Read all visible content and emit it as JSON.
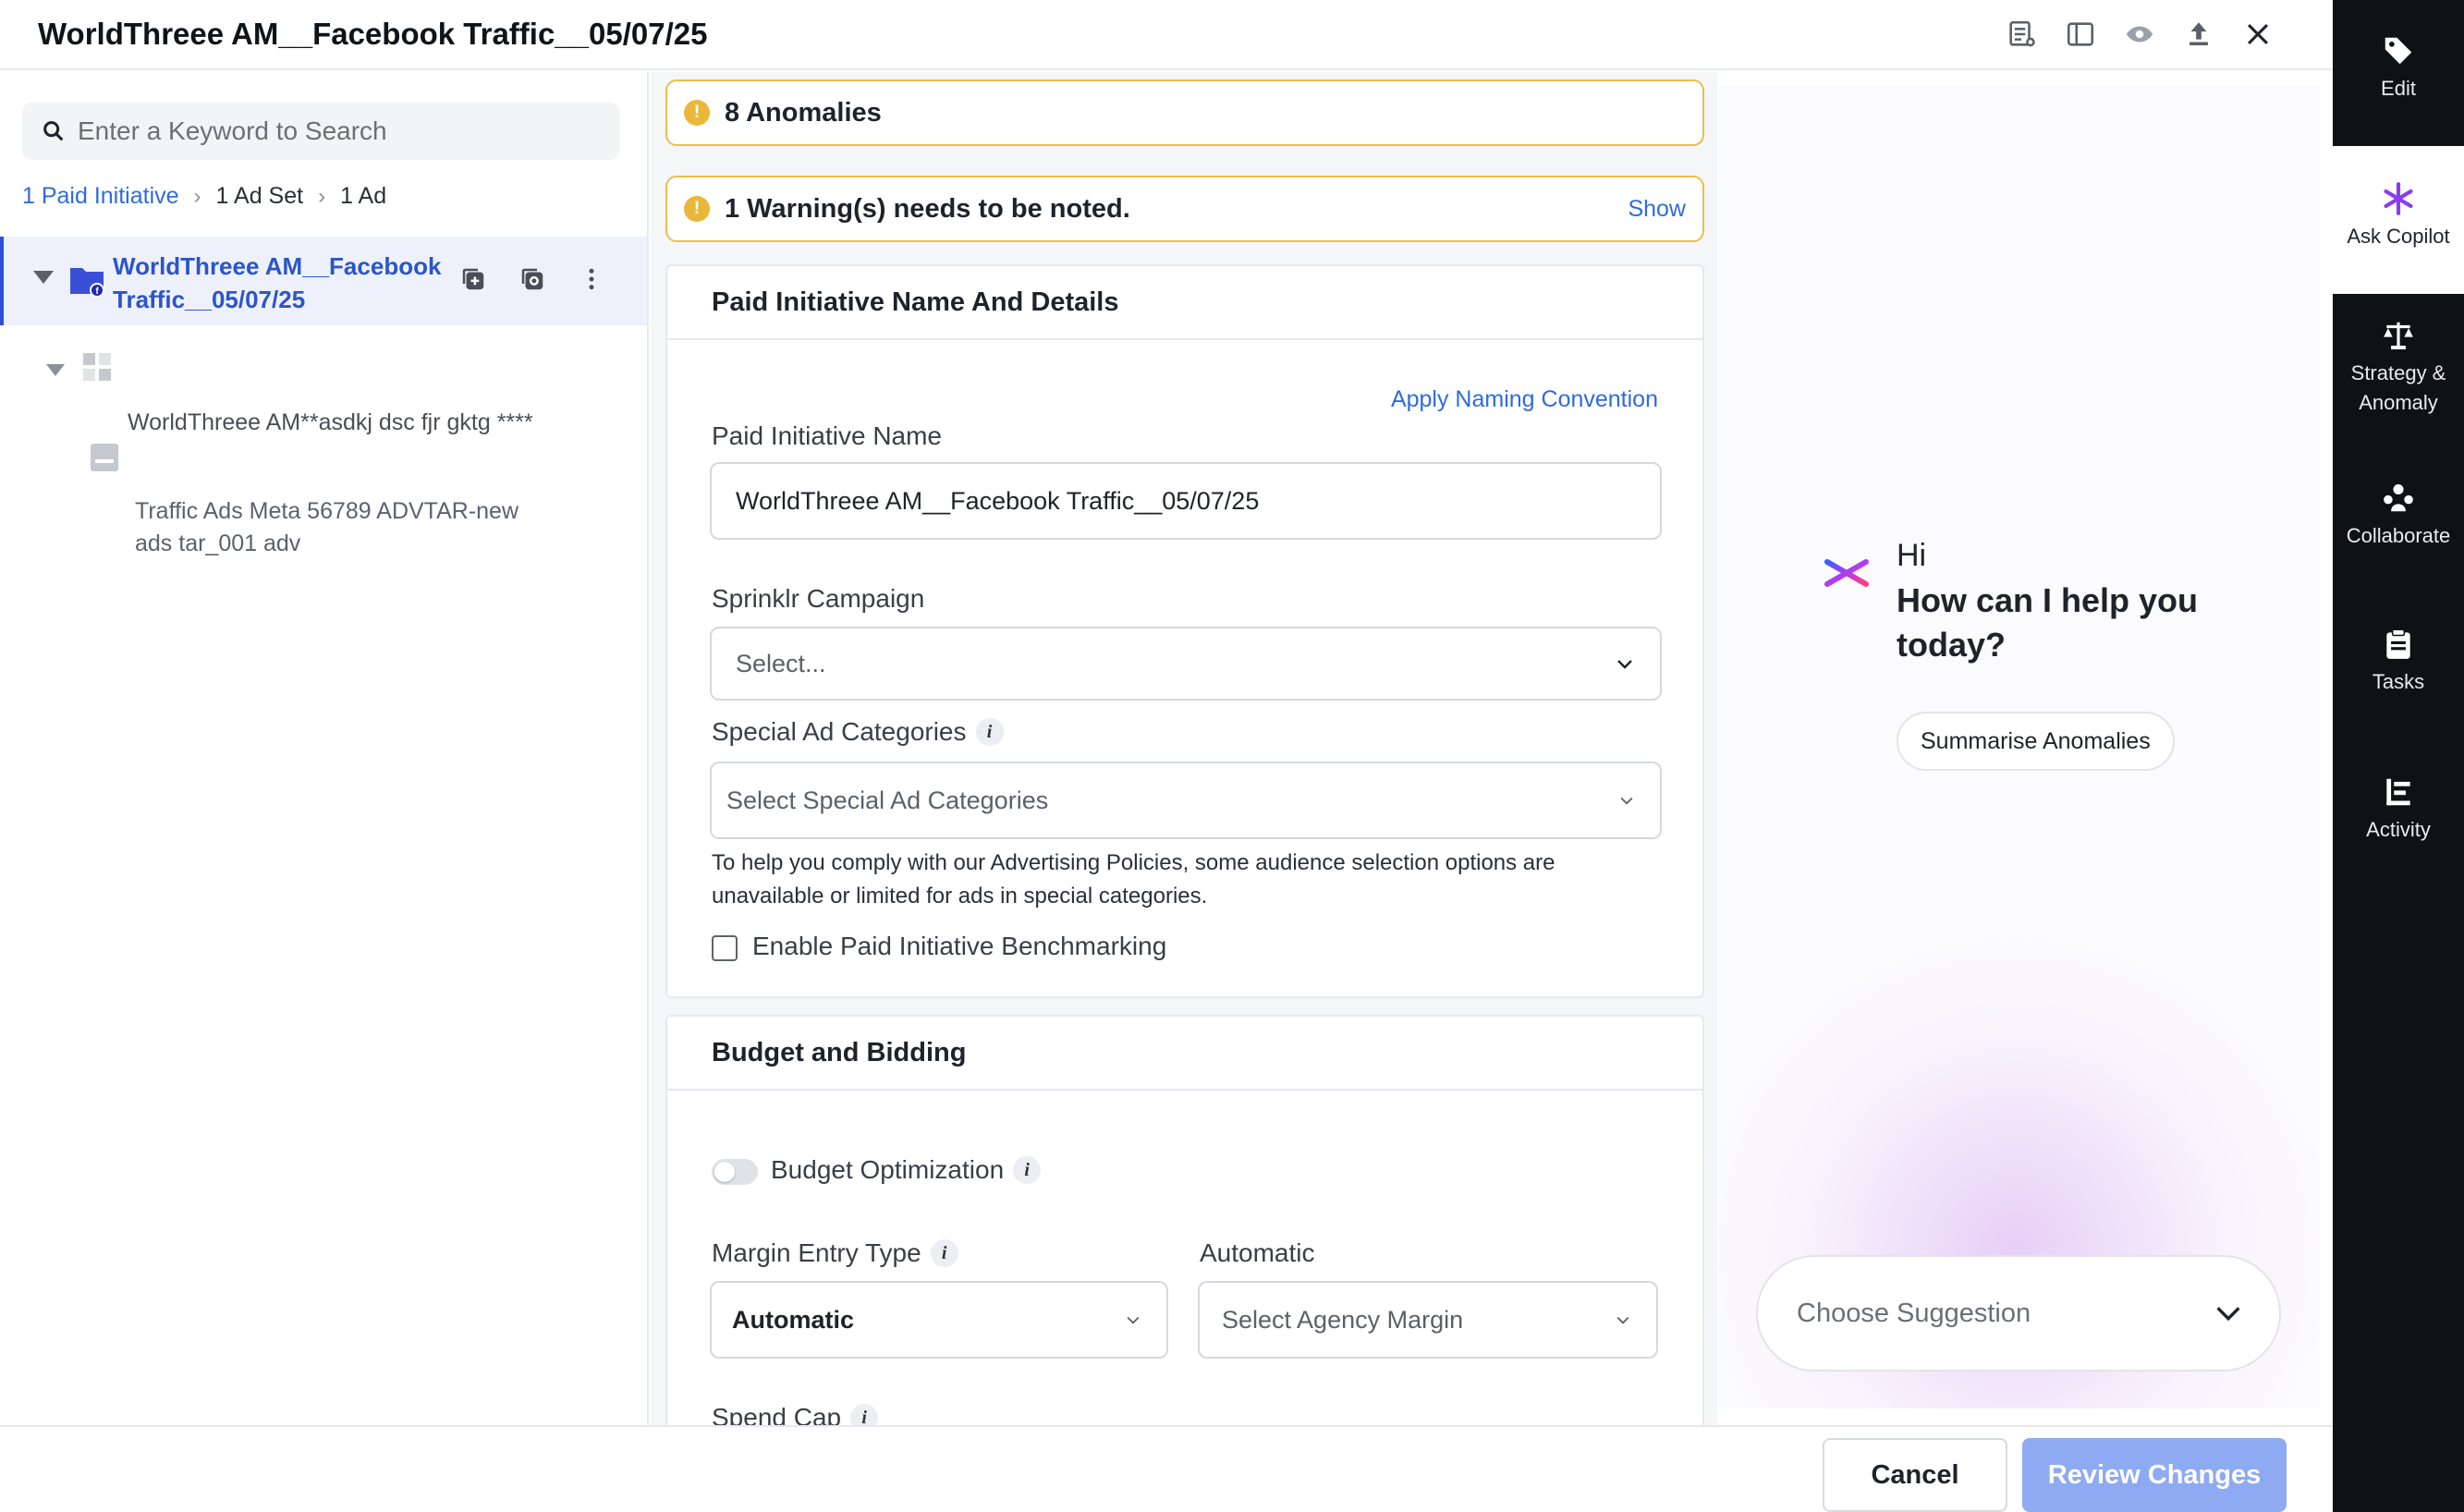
{
  "header": {
    "title": "WorldThreee AM__Facebook Traffic__05/07/25",
    "icons": [
      "list-settings-icon",
      "panel-layout-icon",
      "eye-icon",
      "upload-icon",
      "close-icon"
    ]
  },
  "left_panel": {
    "search": {
      "placeholder": "Enter a Keyword to Search",
      "value": ""
    },
    "breadcrumb": {
      "paid_initiative": "1 Paid Initiative",
      "ad_set": "1 Ad Set",
      "ad": "1 Ad"
    },
    "tree": {
      "initiative": "WorldThreee AM__Facebook Traffic__05/07/25",
      "ad_set": "WorldThreee AM**asdkj dsc fjr gktg ****",
      "ad": "Traffic Ads Meta 56789 ADVTAR-new ads tar_001 adv"
    }
  },
  "form": {
    "anomalies_banner": "8 Anomalies",
    "warning_banner": "1 Warning(s) needs to be noted.",
    "warning_show": "Show",
    "section1": {
      "title": "Paid Initiative Name And Details",
      "apply_naming": "Apply Naming Convention",
      "name_label": "Paid Initiative Name",
      "name_value": "WorldThreee AM__Facebook Traffic__05/07/25",
      "campaign_label": "Sprinklr Campaign",
      "campaign_value": "Select...",
      "special_label": "Special Ad Categories",
      "special_value": "Select Special Ad Categories",
      "help": "To help you comply with our Advertising Policies, some audience selection options are unavailable or limited for ads in special categories.",
      "benchmark_label": "Enable Paid Initiative Benchmarking"
    },
    "section2": {
      "title": "Budget and Bidding",
      "budget_opt_label": "Budget Optimization",
      "margin_label": "Margin Entry Type",
      "margin_value": "Automatic",
      "automatic_label": "Automatic",
      "agency_value": "Select Agency Margin",
      "spend_cap_label": "Spend Cap"
    }
  },
  "copilot": {
    "greeting": "Hi",
    "question": "How can I help you today?",
    "chip": "Summarise Anomalies",
    "select_placeholder": "Choose Suggestion"
  },
  "rail": {
    "items": [
      {
        "label": "Edit",
        "icon": "tag-icon"
      },
      {
        "label": "Ask Copilot",
        "icon": "sparkle-icon"
      },
      {
        "label": "Strategy & Anomaly",
        "icon": "scale-icon"
      },
      {
        "label": "Collaborate",
        "icon": "people-icon"
      },
      {
        "label": "Tasks",
        "icon": "clipboard-icon"
      },
      {
        "label": "Activity",
        "icon": "activity-icon"
      }
    ]
  },
  "footer": {
    "cancel": "Cancel",
    "review": "Review Changes"
  },
  "colors": {
    "accent": "#2f6bdd",
    "warning": "#e9b83a",
    "rail_bg": "#0f1115",
    "review_disabled": "#8eaaf3"
  }
}
